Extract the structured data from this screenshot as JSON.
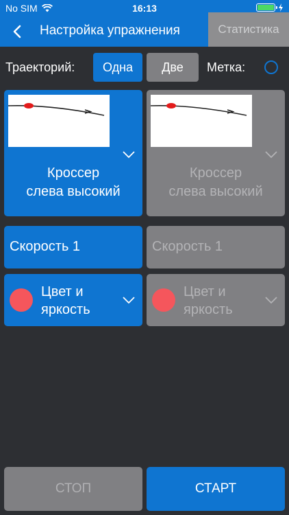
{
  "status_bar": {
    "carrier": "No SIM",
    "time": "16:13"
  },
  "nav": {
    "title": "Настройка упражнения",
    "stats_tab": "Статистика"
  },
  "trajectory": {
    "label": "Траекторий:",
    "one": "Одна",
    "two": "Две",
    "mark_label": "Метка:"
  },
  "left": {
    "trajectory_name": [
      "Кроссер",
      "слева высокий"
    ],
    "speed": "Скорость 1",
    "color": [
      "Цвет и",
      "яркость"
    ]
  },
  "right": {
    "trajectory_name": [
      "Кроссер",
      "слева высокий"
    ],
    "speed": "Скорость 1",
    "color": [
      "Цвет и",
      "яркость"
    ]
  },
  "buttons": {
    "stop": "СТОП",
    "start": "СТАРТ"
  },
  "colors": {
    "accent": "#0f75d1",
    "disabled": "#808083",
    "background": "#2d2f33",
    "target_dot": "#f5565c"
  },
  "icons": [
    "wifi-icon",
    "battery-icon",
    "charging-icon",
    "back-chevron-icon",
    "chevron-down-icon",
    "radio-icon"
  ]
}
